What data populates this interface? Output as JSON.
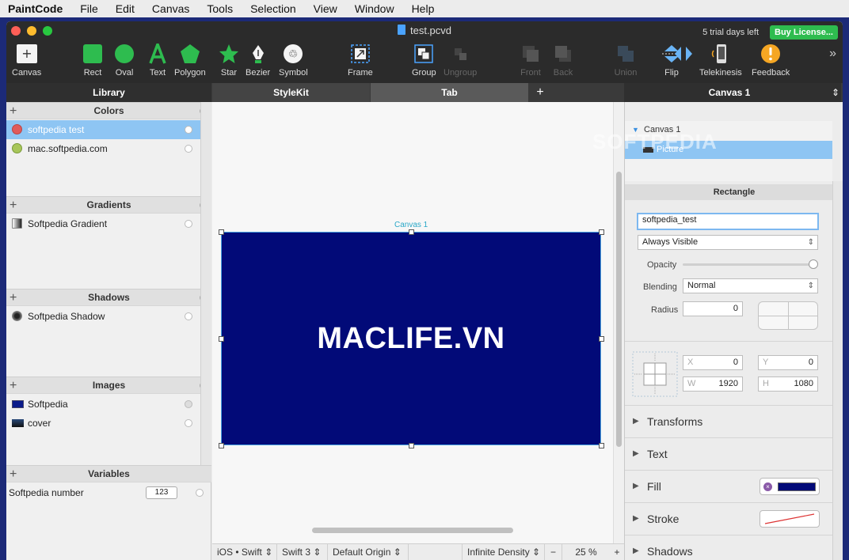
{
  "menubar": {
    "app": "PaintCode",
    "items": [
      "File",
      "Edit",
      "Canvas",
      "Tools",
      "Selection",
      "View",
      "Window",
      "Help"
    ]
  },
  "window": {
    "title": "test.pcvd",
    "trial_text": "5 trial days left",
    "buy_label": "Buy License...",
    "traffic_colors": [
      "#fe5f57",
      "#febc2e",
      "#28c840"
    ]
  },
  "toolbar": {
    "canvas": "Canvas",
    "rect": "Rect",
    "oval": "Oval",
    "text": "Text",
    "polygon": "Polygon",
    "star": "Star",
    "bezier": "Bezier",
    "symbol": "Symbol",
    "frame": "Frame",
    "group": "Group",
    "ungroup": "Ungroup",
    "front": "Front",
    "back": "Back",
    "union": "Union",
    "flip": "Flip",
    "telekinesis": "Telekinesis",
    "feedback": "Feedback",
    "more": "»"
  },
  "tabs": {
    "library": "Library",
    "stylekit": "StyleKit",
    "tab": "Tab",
    "add": "+",
    "inspector": "Canvas 1",
    "inspector_arrows": "⇕"
  },
  "library": {
    "colors": {
      "title": "Colors",
      "items": [
        {
          "label": "softpedia test",
          "color": "#e05b5b"
        },
        {
          "label": "mac.softpedia.com",
          "color": "#a8c65a"
        }
      ]
    },
    "gradients": {
      "title": "Gradients",
      "items": [
        {
          "label": "Softpedia Gradient"
        }
      ]
    },
    "shadows": {
      "title": "Shadows",
      "items": [
        {
          "label": "Softpedia Shadow"
        }
      ]
    },
    "images": {
      "title": "Images",
      "items": [
        {
          "label": "Softpedia"
        },
        {
          "label": "cover"
        }
      ]
    },
    "variables": {
      "title": "Variables",
      "items": [
        {
          "label": "Softpedia number",
          "value": "123"
        }
      ]
    }
  },
  "canvas": {
    "label": "Canvas 1",
    "artboard_text": "MACLIFE.VN",
    "artboard_color": "#020a78"
  },
  "bottombar": {
    "platform": "iOS • Swift",
    "swift": "Swift 3",
    "origin": "Default Origin",
    "density": "Infinite Density",
    "minus": "−",
    "zoom": "25 %",
    "plus": "+"
  },
  "inspector": {
    "tree": {
      "canvas": "Canvas 1",
      "picture": "Picture"
    },
    "section": "Rectangle",
    "name_value": "softpedia_test",
    "visibility": "Always Visible",
    "opacity_label": "Opacity",
    "opacity_value": 1.0,
    "blending_label": "Blending",
    "blending_value": "Normal",
    "radius_label": "Radius",
    "radius_value": "0",
    "x_label": "X",
    "x_value": "0",
    "y_label": "Y",
    "y_value": "0",
    "w_label": "W",
    "w_value": "1920",
    "h_label": "H",
    "h_value": "1080",
    "groups": [
      "Transforms",
      "Text",
      "Fill",
      "Stroke",
      "Shadows"
    ]
  },
  "watermark": "SOFTPEDIA"
}
